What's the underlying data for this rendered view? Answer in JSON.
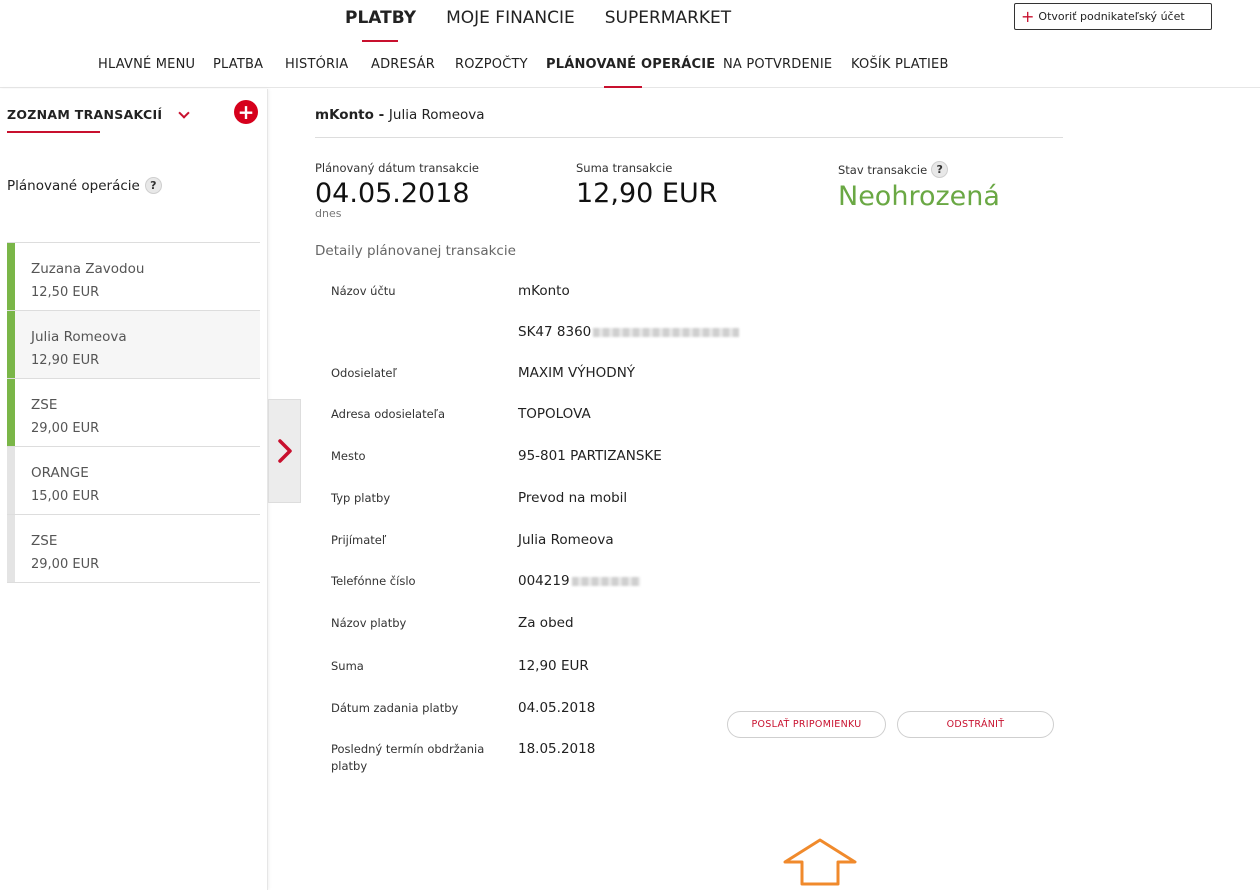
{
  "topnav": {
    "tabs": [
      {
        "label": "PLATBY",
        "active": true
      },
      {
        "label": "MOJE FINANCIE",
        "active": false
      },
      {
        "label": "SUPERMARKET",
        "active": false
      }
    ],
    "open_account_label": "Otvoriť podnikateľský účet"
  },
  "subnav": {
    "items": [
      {
        "label": "HLAVNÉ MENU"
      },
      {
        "label": "PLATBA"
      },
      {
        "label": "HISTÓRIA"
      },
      {
        "label": "ADRESÁR"
      },
      {
        "label": "ROZPOČTY"
      },
      {
        "label": "PLÁNOVANÉ OPERÁCIE",
        "active": true
      },
      {
        "label": "NA POTVRDENIE"
      },
      {
        "label": "KOŠÍK PLATIEB"
      }
    ]
  },
  "sidebar": {
    "title": "ZOZNAM TRANSAKCIÍ",
    "add_symbol": "+",
    "section_label": "Plánované operácie",
    "help_symbol": "?",
    "transactions": [
      {
        "name": "Zuzana Zavodou",
        "amount": "12,50 EUR",
        "status_color": "#7ab648"
      },
      {
        "name": "Julia Romeova",
        "amount": "12,90 EUR",
        "status_color": "#7ab648",
        "selected": true
      },
      {
        "name": "ZSE",
        "amount": "29,00 EUR",
        "status_color": "#7ab648"
      },
      {
        "name": "ORANGE",
        "amount": "15,00 EUR",
        "status_color": "#e4e4e4"
      },
      {
        "name": "ZSE",
        "amount": "29,00 EUR",
        "status_color": "#e4e4e4"
      }
    ]
  },
  "main": {
    "account_name": "mKonto - ",
    "account_owner": "Julia Romeova",
    "planned_date_label": "Plánovaný dátum transakcie",
    "planned_date_value": "04.05.2018",
    "planned_date_sub": "dnes",
    "amount_label": "Suma transakcie",
    "amount_value": "12,90 EUR",
    "status_label": "Stav transakcie",
    "status_value": "Neohrozená",
    "status_color": "#6aa844",
    "details_title": "Detaily plánovanej transakcie",
    "details": [
      {
        "key": "Názov účtu",
        "value": "mKonto"
      },
      {
        "key": "",
        "value": "SK47 8360",
        "masked": true
      },
      {
        "key": "Odosielateľ",
        "value": "MAXIM VÝHODNÝ"
      },
      {
        "key": "Adresa odosielateľa",
        "value": "TOPOLOVA"
      },
      {
        "key": "Mesto",
        "value": "95-801 PARTIZANSKE"
      },
      {
        "key": "Typ platby",
        "value": "Prevod na mobil"
      },
      {
        "key": "Prijímateľ",
        "value": "Julia Romeova"
      },
      {
        "key": "Telefónne číslo",
        "value": "004219",
        "masked": true
      },
      {
        "key": "Názov platby",
        "value": "Za obed"
      },
      {
        "key": "Suma",
        "value": "12,90 EUR"
      },
      {
        "key": "Dátum zadania platby",
        "value": "04.05.2018"
      },
      {
        "key": "Posledný termín obdržania platby",
        "value": "18.05.2018"
      }
    ],
    "send_reminder_label": "POSLAŤ PRIPOMIENKU",
    "delete_label": "ODSTRÁNIŤ"
  }
}
